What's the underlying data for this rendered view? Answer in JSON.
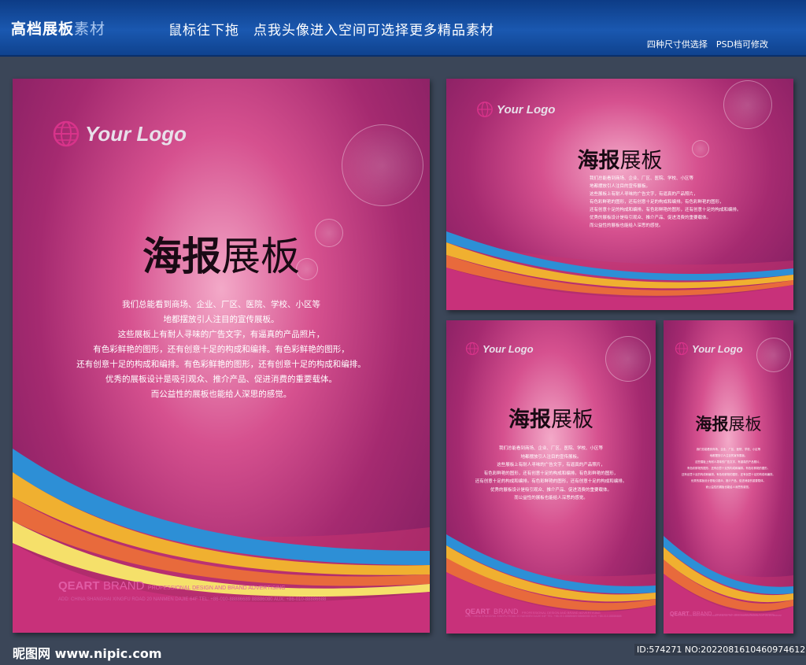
{
  "banner": {
    "title_main": "高档展板",
    "title_dim": "素材",
    "subtitle": "鼠标往下拖　点我头像进入空间可选择更多精品素材",
    "right_note": "四种尺寸供选择　PSD档可修改"
  },
  "poster": {
    "logo": "Your Logo",
    "headline_bold": "海报",
    "headline_thin": "展板",
    "body_lines": [
      "我们总能看到商场、企业、厂区、医院、学校、小区等",
      "地都摆放引人注目的宣传展板。",
      "这些展板上有耐人寻味的广告文字，有逼真的产品照片，",
      "有色彩鲜艳的图形，还有创意十足的构成和编排。有色彩鲜艳的图形，",
      "还有创意十足的构成和编排。有色彩鲜艳的图形，还有创意十足的构成和编排。",
      "优秀的展板设计是吸引观众、推介产品、促进消费的重要载体。",
      "而公益性的展板也能给人深思的感觉。"
    ],
    "brand_bold": "QEART",
    "brand_word": "BRAND",
    "brand_tagline": "PROFESSIONAL DESIGN AND BRAND ADVERTISING",
    "address": "ADD: CHINA SHANGHAI XINGFU ROAD 20 NANMEN DAJIE 64F   TEL: +86-010-88886689  88886080   AUX: +86-010-88886688"
  },
  "footer": {
    "watermark": "昵图网 www.nipic.com",
    "id_text": "ID:574271 NO:20220816104609746125"
  },
  "colors": {
    "banner": "#1a58b0",
    "page_bg": "#3b4658",
    "poster_magenta": "#a52a70",
    "brand_pink": "#e15ca5"
  }
}
